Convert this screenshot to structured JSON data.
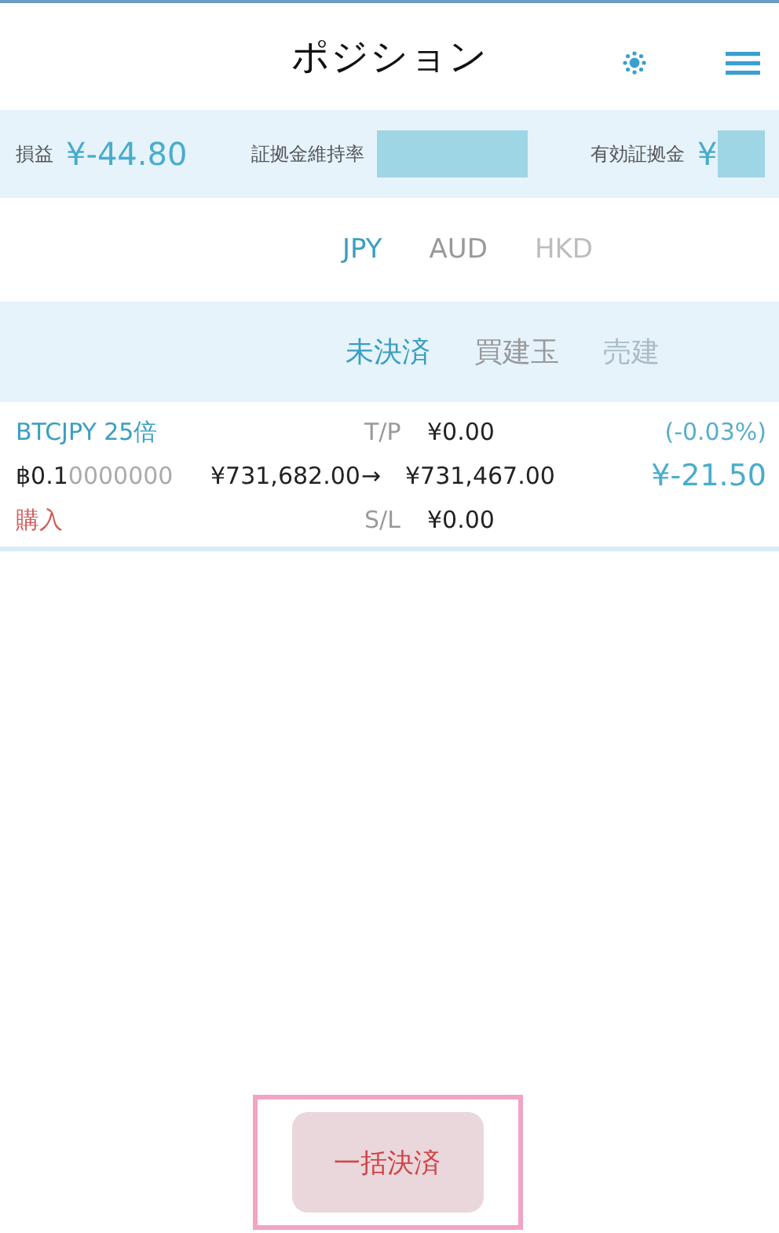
{
  "header": {
    "title": "ポジション"
  },
  "summary": [
    {
      "kind": "value",
      "label": "損益",
      "value": "¥-44.80"
    },
    {
      "kind": "redacted",
      "label": "証拠金維持率"
    },
    {
      "kind": "redacted",
      "label": "有効証拠金",
      "value": "¥"
    }
  ],
  "currencies": [
    {
      "label": "JPY",
      "selected": true,
      "faded": false
    },
    {
      "label": "AUD",
      "selected": false,
      "faded": false
    },
    {
      "label": "HKD",
      "selected": false,
      "faded": true
    }
  ],
  "position_tabs": [
    {
      "label": "未決済",
      "selected": true,
      "faded": false
    },
    {
      "label": "買建玉",
      "selected": false,
      "faded": false
    },
    {
      "label": "売建",
      "selected": false,
      "faded": true
    }
  ],
  "positions": [
    {
      "symbol": "BTCJPY 25倍",
      "amount_main": "฿0.1",
      "amount_trailing": "0000000",
      "side": "購入",
      "tp_label": "T/P",
      "tp": "¥0.00",
      "sl_label": "S/L",
      "sl": "¥0.00",
      "open_price": "¥731,682.00",
      "arrow": "→",
      "current_price": "¥731,467.00",
      "percent": "(-0.03%)",
      "pnl": "¥-21.50"
    }
  ],
  "close_all_button": {
    "label": "一括決済",
    "highlighted": true
  }
}
